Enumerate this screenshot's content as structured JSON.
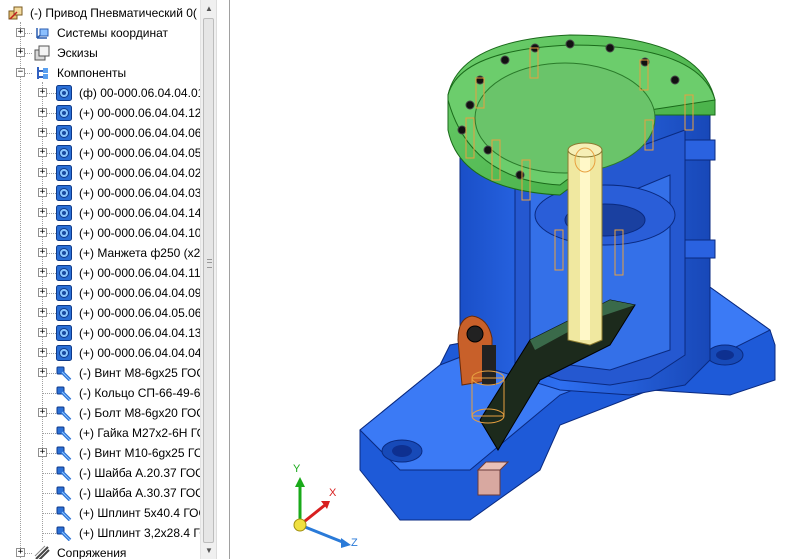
{
  "tree": {
    "root_label": "(-) Привод Пневматический 0(",
    "groups": [
      {
        "label": "Системы координат",
        "icon": "coordinate-systems-icon"
      },
      {
        "label": "Эскизы",
        "icon": "sketches-icon"
      },
      {
        "label": "Компоненты",
        "icon": "components-icon"
      }
    ],
    "components": [
      {
        "label": "(ф) 00-000.06.04.04.01",
        "icon": "part-icon"
      },
      {
        "label": "(+) 00-000.06.04.04.12 |",
        "icon": "part-icon"
      },
      {
        "label": "(+) 00-000.06.04.04.06 |",
        "icon": "part-icon"
      },
      {
        "label": "(+) 00-000.06.04.04.05 |",
        "icon": "part-icon"
      },
      {
        "label": "(+) 00-000.06.04.04.02 ⁻",
        "icon": "part-icon"
      },
      {
        "label": "(+) 00-000.06.04.04.03 |",
        "icon": "part-icon"
      },
      {
        "label": "(+) 00-000.06.04.04.14 (",
        "icon": "part-icon"
      },
      {
        "label": "(+) 00-000.06.04.04.10 |",
        "icon": "part-icon"
      },
      {
        "label": "(+) Манжета ф250 (x2)",
        "icon": "part-icon"
      },
      {
        "label": "(+) 00-000.06.04.04.11 ,",
        "icon": "part-icon"
      },
      {
        "label": "(+) 00-000.06.04.04.09 |",
        "icon": "part-icon"
      },
      {
        "label": "(+) 00-000.06.04.05.06 |",
        "icon": "part-icon"
      },
      {
        "label": "(+) 00-000.06.04.04.13 (",
        "icon": "part-icon"
      },
      {
        "label": "(+) 00-000.06.04.04.04 |",
        "icon": "part-icon"
      }
    ],
    "fasteners": [
      {
        "label": "(-) Винт М8-6gx25 ГОС",
        "expand": true
      },
      {
        "label": "(-) Кольцо СП-66-49-6",
        "expand": false
      },
      {
        "label": "(-) Болт М8-6gx20 ГОС",
        "expand": true
      },
      {
        "label": "(+) Гайка М27x2-6Н ГО",
        "expand": false
      },
      {
        "label": "(-) Винт М10-6gx25 ГС",
        "expand": true
      },
      {
        "label": "(-) Шайба А.20.37 ГОС",
        "expand": false
      },
      {
        "label": "(-) Шайба А.30.37 ГОС",
        "expand": false
      },
      {
        "label": "(+) Шплинт 5x40.4 ГОСТ",
        "expand": false
      },
      {
        "label": "(+) Шплинт 3,2x28.4 ГО",
        "expand": false
      }
    ],
    "last_group": {
      "label": "Сопряжения",
      "icon": "mates-icon"
    }
  },
  "triad": {
    "x_label": "X",
    "y_label": "Y",
    "z_label": "Z"
  },
  "colors": {
    "housing": "#1f5fd6",
    "cover": "#5cbf5c",
    "shaft": "#f0e8a0",
    "bracket": "#c8602a",
    "dark_part": "#1c2a1c"
  }
}
